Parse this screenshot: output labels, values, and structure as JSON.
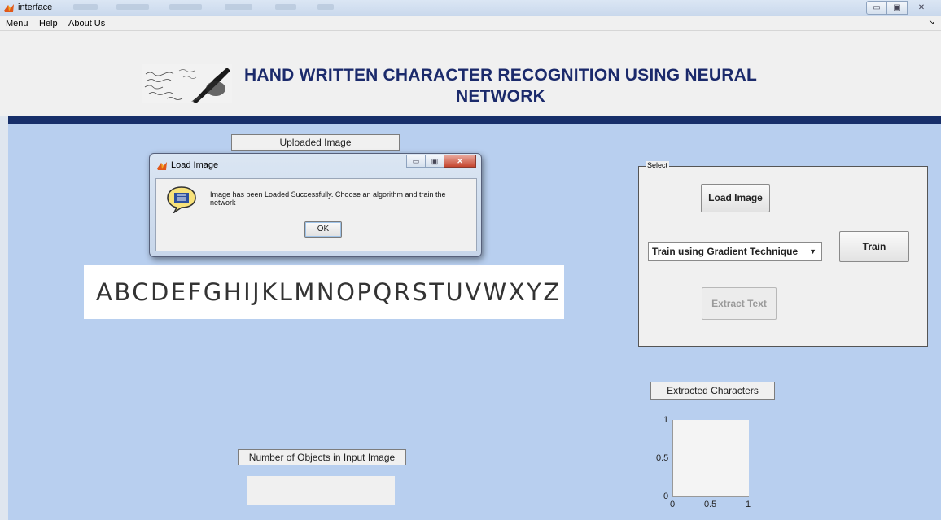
{
  "window": {
    "title": "interface",
    "controls": [
      "minimize",
      "maximize",
      "close"
    ]
  },
  "menubar": {
    "items": [
      "Menu",
      "Help",
      "About Us"
    ]
  },
  "header": {
    "title_line1": "HAND WRITTEN CHARACTER RECOGNITION USING NEURAL",
    "title_line2": "NETWORK"
  },
  "labels": {
    "uploaded_image": "Uploaded Image",
    "number_of_objects": "Number of Objects in Input Image",
    "extracted_characters": "Extracted Characters"
  },
  "uploaded_text": "ABCDEFGHIJKLMNOPQRSTUVWXYZ",
  "select_panel": {
    "legend": "Select",
    "load_image": "Load Image",
    "train": "Train",
    "extract_text": "Extract Text",
    "algorithm_selected": "Train using Gradient Technique"
  },
  "axes": {
    "y_ticks": [
      "1",
      "0.5",
      "0"
    ],
    "x_ticks": [
      "0",
      "0.5",
      "1"
    ]
  },
  "dialog": {
    "title": "Load Image",
    "message": "Image has been Loaded Successfully. Choose an algorithm and train the network",
    "ok_label": "OK"
  },
  "colors": {
    "panel_bg": "#b8cfef",
    "header_text": "#1b2a6b",
    "accent_bar": "#172f6a"
  }
}
